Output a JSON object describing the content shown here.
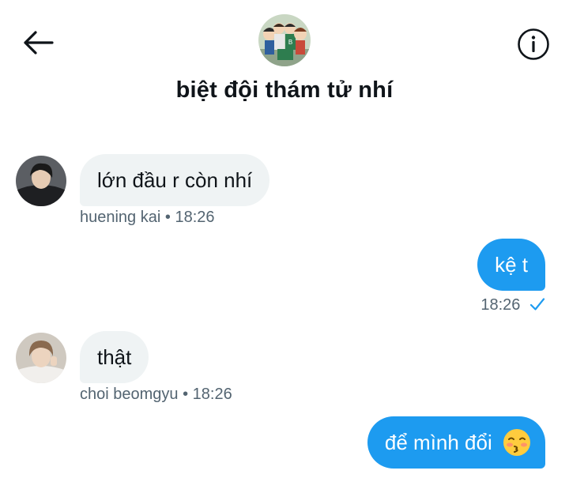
{
  "header": {
    "title": "biệt đội thám tử nhí"
  },
  "messages": [
    {
      "direction": "incoming",
      "text": "lớn đầu r còn nhí",
      "sender": "huening kai",
      "separator": "•",
      "time": "18:26"
    },
    {
      "direction": "outgoing",
      "text": "kệ t",
      "time": "18:26",
      "status": "sent-check-icon"
    },
    {
      "direction": "incoming",
      "text": "thật",
      "sender": "choi beomgyu",
      "separator": "•",
      "time": "18:26"
    },
    {
      "direction": "outgoing",
      "text": "để mình đổi",
      "emoji": "kissing-face-closed-eyes"
    }
  ],
  "colors": {
    "accent": "#1d9bf0",
    "incoming_bubble": "#eff3f4",
    "meta_text": "#536471",
    "text": "#0f1419"
  },
  "icons": {
    "back": "arrow-left-icon",
    "info": "info-icon"
  }
}
